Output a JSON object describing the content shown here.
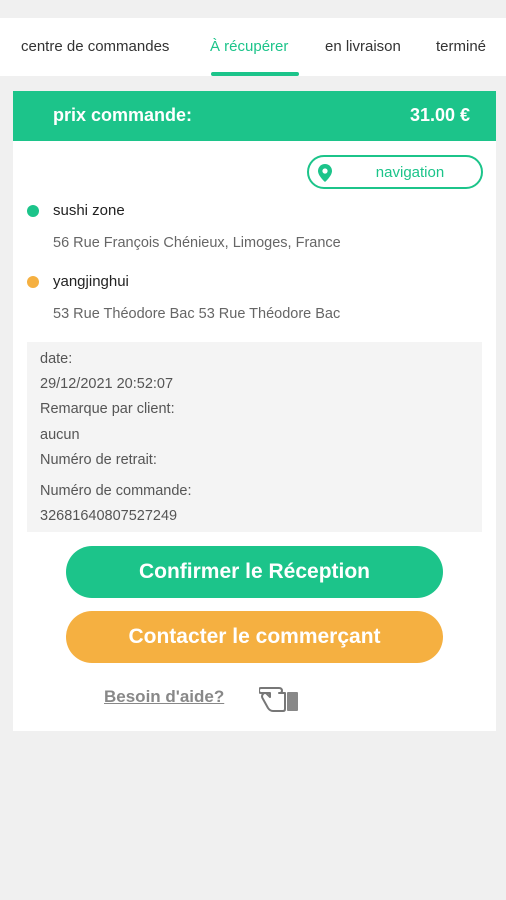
{
  "tabs": [
    {
      "label": "centre de commandes",
      "active": false
    },
    {
      "label": "À récupérer",
      "active": true
    },
    {
      "label": "en livraison",
      "active": false
    },
    {
      "label": "terminé",
      "active": false
    }
  ],
  "price": {
    "label": "prix commande:",
    "value": "31.00 €"
  },
  "navigation": {
    "label": "navigation",
    "icon": "map-pin-icon"
  },
  "merchant": {
    "name": "sushi zone",
    "address": "56 Rue François Chénieux, Limoges, France"
  },
  "customer": {
    "name": "yangjinghui",
    "address": "53 Rue Théodore Bac 53 Rue Théodore Bac"
  },
  "info": {
    "date_label": "date:",
    "date_value": "29/12/2021 20:52:07",
    "remark_label": "Remarque par client:",
    "remark_value": "aucun",
    "pickup_label": "Numéro de retrait:",
    "order_label": "Numéro de commande:",
    "order_value": "32681640807527249"
  },
  "actions": {
    "confirm": "Confirmer le Réception",
    "contact": "Contacter le commerçant",
    "help": "Besoin d'aide?"
  },
  "colors": {
    "accent": "#1cc48a",
    "secondary": "#f5b041"
  }
}
